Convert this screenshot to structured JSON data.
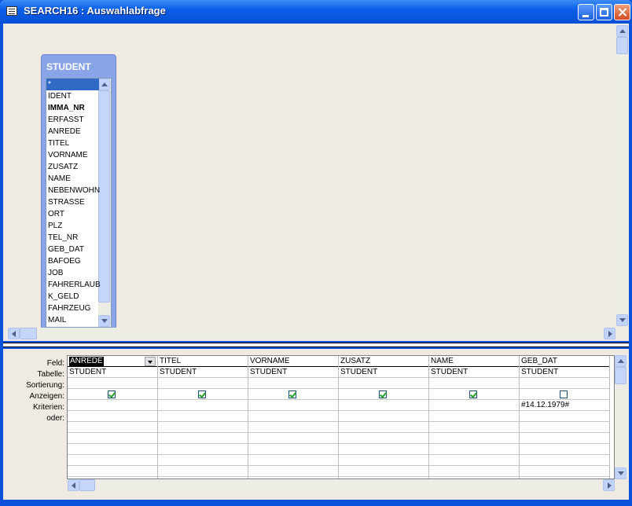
{
  "window": {
    "title": "SEARCH16 : Auswahlabfrage"
  },
  "table": {
    "name": "STUDENT",
    "fields": [
      "*",
      "IDENT",
      "IMMA_NR",
      "ERFASST",
      "ANREDE",
      "TITEL",
      "VORNAME",
      "ZUSATZ",
      "NAME",
      "NEBENWOHN",
      "STRASSE",
      "ORT",
      "PLZ",
      "TEL_NR",
      "GEB_DAT",
      "BAFOEG",
      "JOB",
      "FAHRERLAUB",
      "K_GELD",
      "FAHRZEUG",
      "MAIL"
    ],
    "selected_field": "*",
    "key_field": "IMMA_NR"
  },
  "grid": {
    "row_labels": [
      "Feld:",
      "Tabelle:",
      "Sortierung:",
      "Anzeigen:",
      "Kriterien:",
      "oder:"
    ],
    "columns": [
      {
        "feld": "ANREDE",
        "tabelle": "STUDENT",
        "sortierung": "",
        "anzeigen": true,
        "kriterien": "",
        "oder": ""
      },
      {
        "feld": "TITEL",
        "tabelle": "STUDENT",
        "sortierung": "",
        "anzeigen": true,
        "kriterien": "",
        "oder": ""
      },
      {
        "feld": "VORNAME",
        "tabelle": "STUDENT",
        "sortierung": "",
        "anzeigen": true,
        "kriterien": "",
        "oder": ""
      },
      {
        "feld": "ZUSATZ",
        "tabelle": "STUDENT",
        "sortierung": "",
        "anzeigen": true,
        "kriterien": "",
        "oder": ""
      },
      {
        "feld": "NAME",
        "tabelle": "STUDENT",
        "sortierung": "",
        "anzeigen": true,
        "kriterien": "",
        "oder": ""
      },
      {
        "feld": "GEB_DAT",
        "tabelle": "STUDENT",
        "sortierung": "",
        "anzeigen": false,
        "kriterien": "#14.12.1979#",
        "oder": ""
      }
    ]
  },
  "colors": {
    "titlebar": "#0a5ee8",
    "table_header": "#8aa4e8",
    "selection": "#316ac5",
    "background": "#efebe2"
  }
}
